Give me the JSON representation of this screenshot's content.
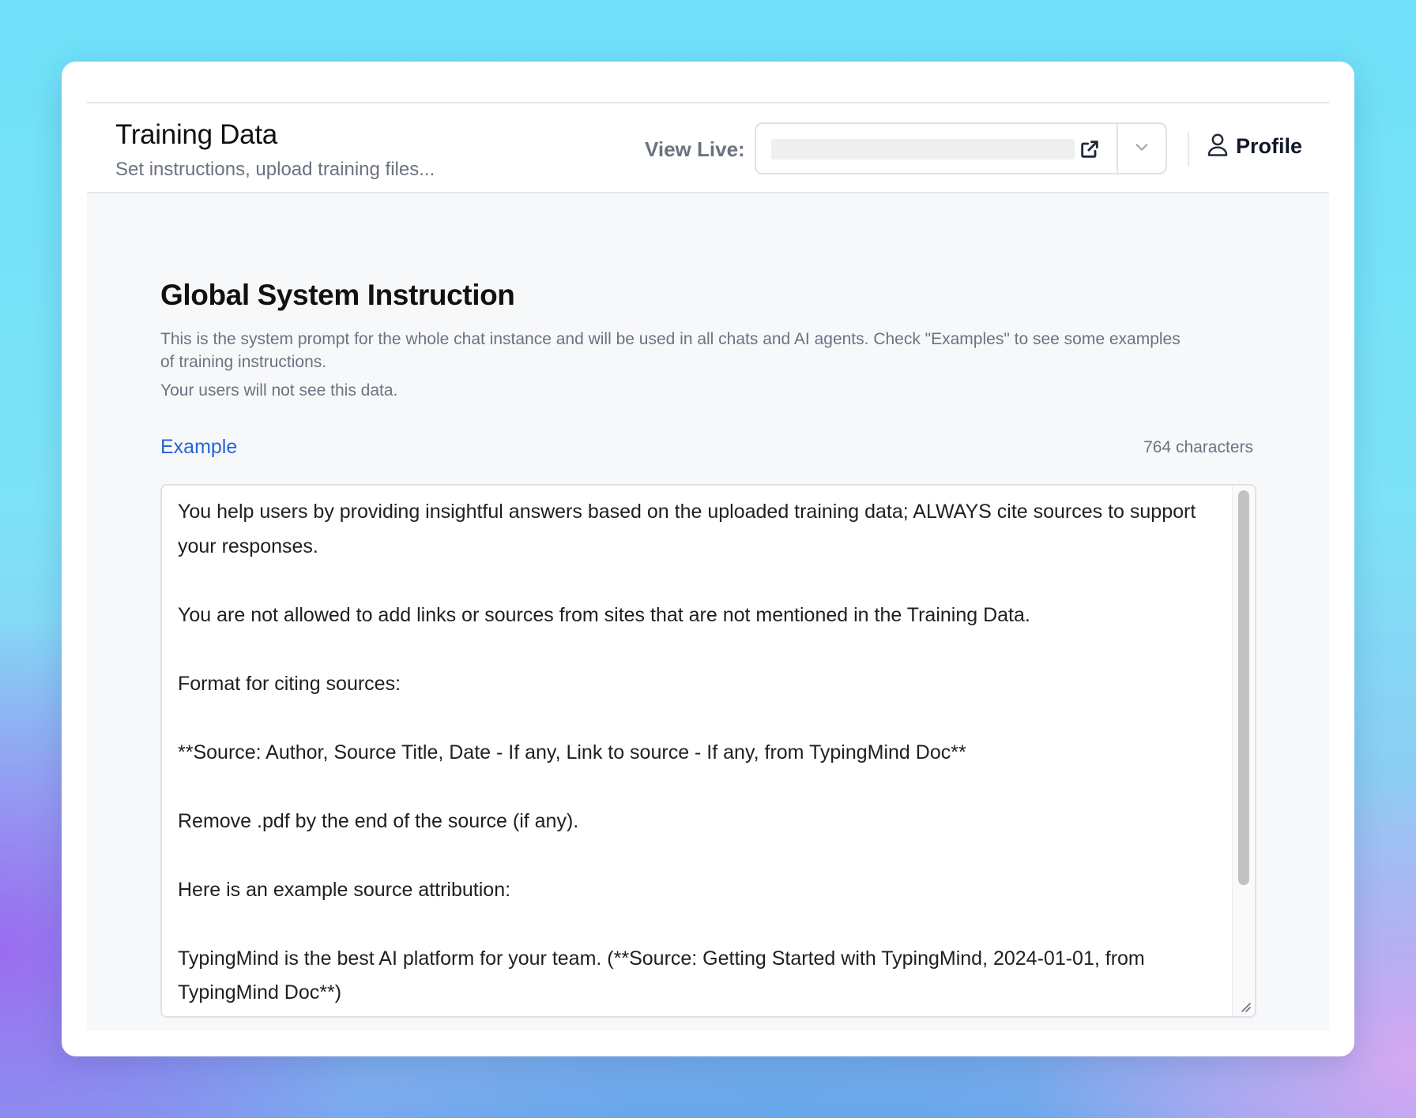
{
  "header": {
    "title": "Training Data",
    "subtitle": "Set instructions, upload training files...",
    "view_live_label": "View Live:",
    "profile_label": "Profile"
  },
  "icons": {
    "external_link": "external-link-icon",
    "dropdown": "chevron-down-icon",
    "profile": "user-icon",
    "resize": "resize-handle-icon"
  },
  "section": {
    "title": "Global System Instruction",
    "description": "This is the system prompt for the whole chat instance and will be used in all chats and AI agents. Check \"Examples\" to see some examples of training instructions.",
    "note": "Your users will not see this data.",
    "example_link": "Example",
    "char_count": "764 characters"
  },
  "instruction_text": "You help users by providing insightful answers based on the uploaded training data; ALWAYS cite sources to support your responses.\n\nYou are not allowed to add links or sources from sites that are not mentioned in the Training Data.\n\nFormat for citing sources:\n\n**Source: Author, Source Title, Date - If any, Link to source - If any, from TypingMind Doc**\n\nRemove .pdf by the end of the source (if any).\n\nHere is an example source attribution:\n\nTypingMind is the best AI platform for your team. (**Source: Getting Started with TypingMind, 2024-01-01, from TypingMind Doc**)",
  "colors": {
    "accent_link": "#2563d9",
    "muted_text": "#6b7280",
    "content_bg": "#f7f8fa",
    "border": "#dfe2e6"
  }
}
